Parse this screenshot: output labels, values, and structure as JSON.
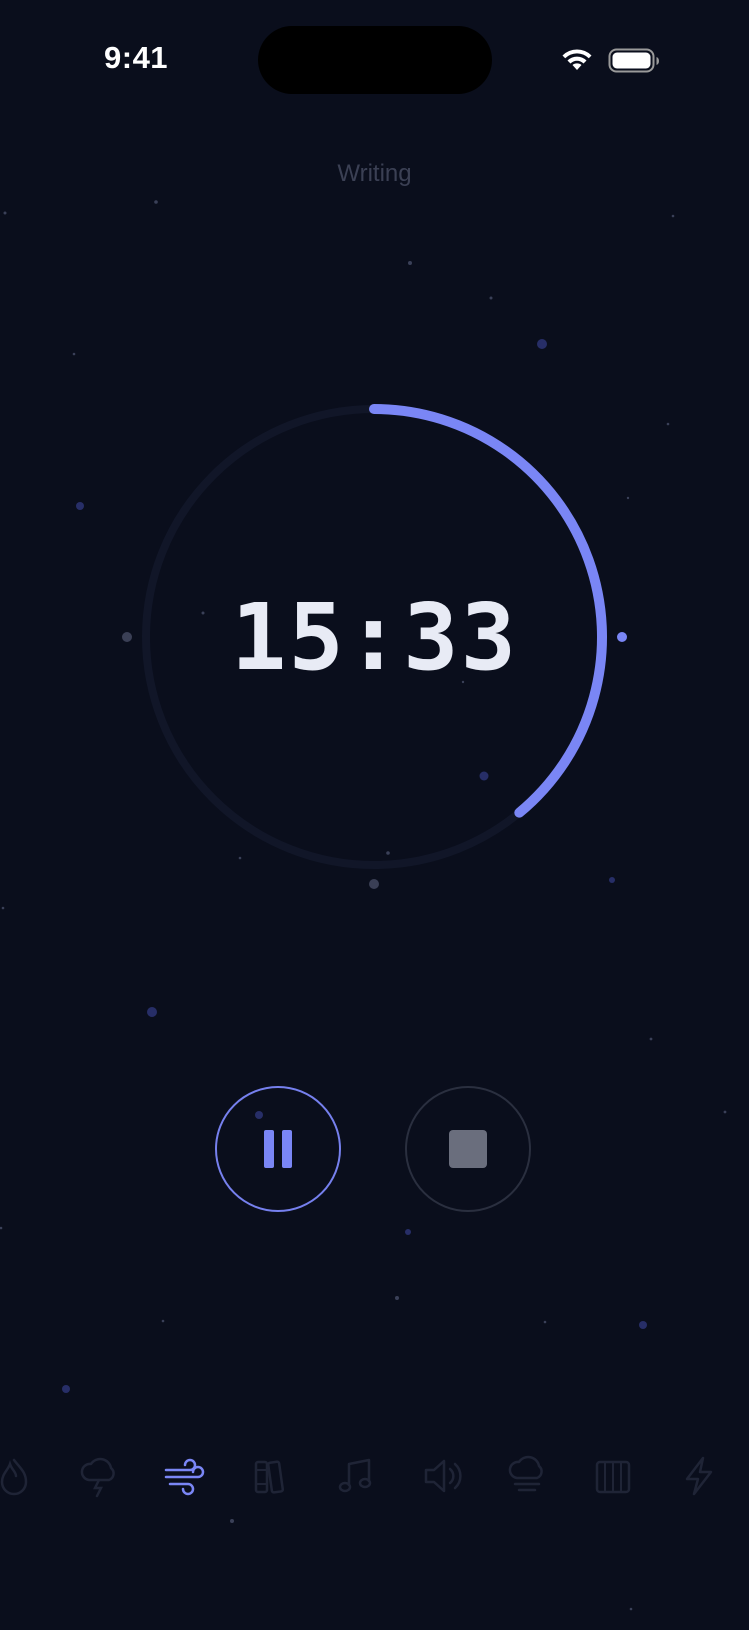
{
  "status_bar": {
    "time": "9:41"
  },
  "session": {
    "label": "Writing"
  },
  "timer": {
    "display": "15:33",
    "progress": 0.39,
    "accent_color": "#7a86f5"
  },
  "controls": {
    "pause_icon": "pause-icon",
    "stop_icon": "stop-icon"
  },
  "sound_tabs": [
    {
      "icon": "fire-icon",
      "active": false
    },
    {
      "icon": "thunderstorm-icon",
      "active": false
    },
    {
      "icon": "wind-icon",
      "active": true
    },
    {
      "icon": "books-icon",
      "active": false
    },
    {
      "icon": "music-note-icon",
      "active": false
    },
    {
      "icon": "speaker-icon",
      "active": false
    },
    {
      "icon": "fog-cloud-icon",
      "active": false
    },
    {
      "icon": "piano-icon",
      "active": false
    },
    {
      "icon": "lightning-icon",
      "active": false
    }
  ],
  "colors": {
    "background": "#0a0e1c",
    "accent": "#7a86f5",
    "muted": "#2a2f3f"
  }
}
